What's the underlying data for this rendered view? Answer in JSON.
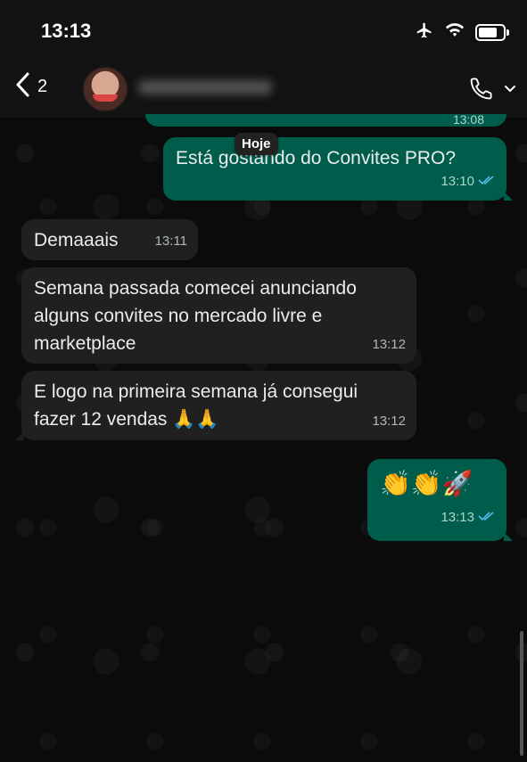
{
  "status_bar": {
    "time": "13:13",
    "icons": [
      "airplane-icon",
      "wifi-icon",
      "battery-icon"
    ]
  },
  "header": {
    "back_count": "2",
    "icons": [
      "chevron-left-icon",
      "avatar",
      "phone-icon",
      "chevron-down-icon"
    ]
  },
  "previous_message": {
    "time": "13:08"
  },
  "date_separator": "Hoje",
  "messages": [
    {
      "direction": "out",
      "text": "Está gostando do Convites PRO?",
      "time": "13:10",
      "read": true
    },
    {
      "direction": "in",
      "text": "Demaaais",
      "time": "13:11"
    },
    {
      "direction": "in",
      "text": "Semana passada comecei anunciando alguns convites no mercado livre e marketplace",
      "time": "13:12"
    },
    {
      "direction": "in",
      "text": "E logo na primeira semana já consegui fazer 12 vendas 🙏🙏",
      "time": "13:12"
    },
    {
      "direction": "out",
      "text": "👏👏🚀",
      "time": "13:13",
      "read": true
    }
  ],
  "colors": {
    "outgoing_bubble": "#005c4b",
    "incoming_bubble": "#202020",
    "read_check": "#53bdeb",
    "background": "#0b0b0b"
  }
}
